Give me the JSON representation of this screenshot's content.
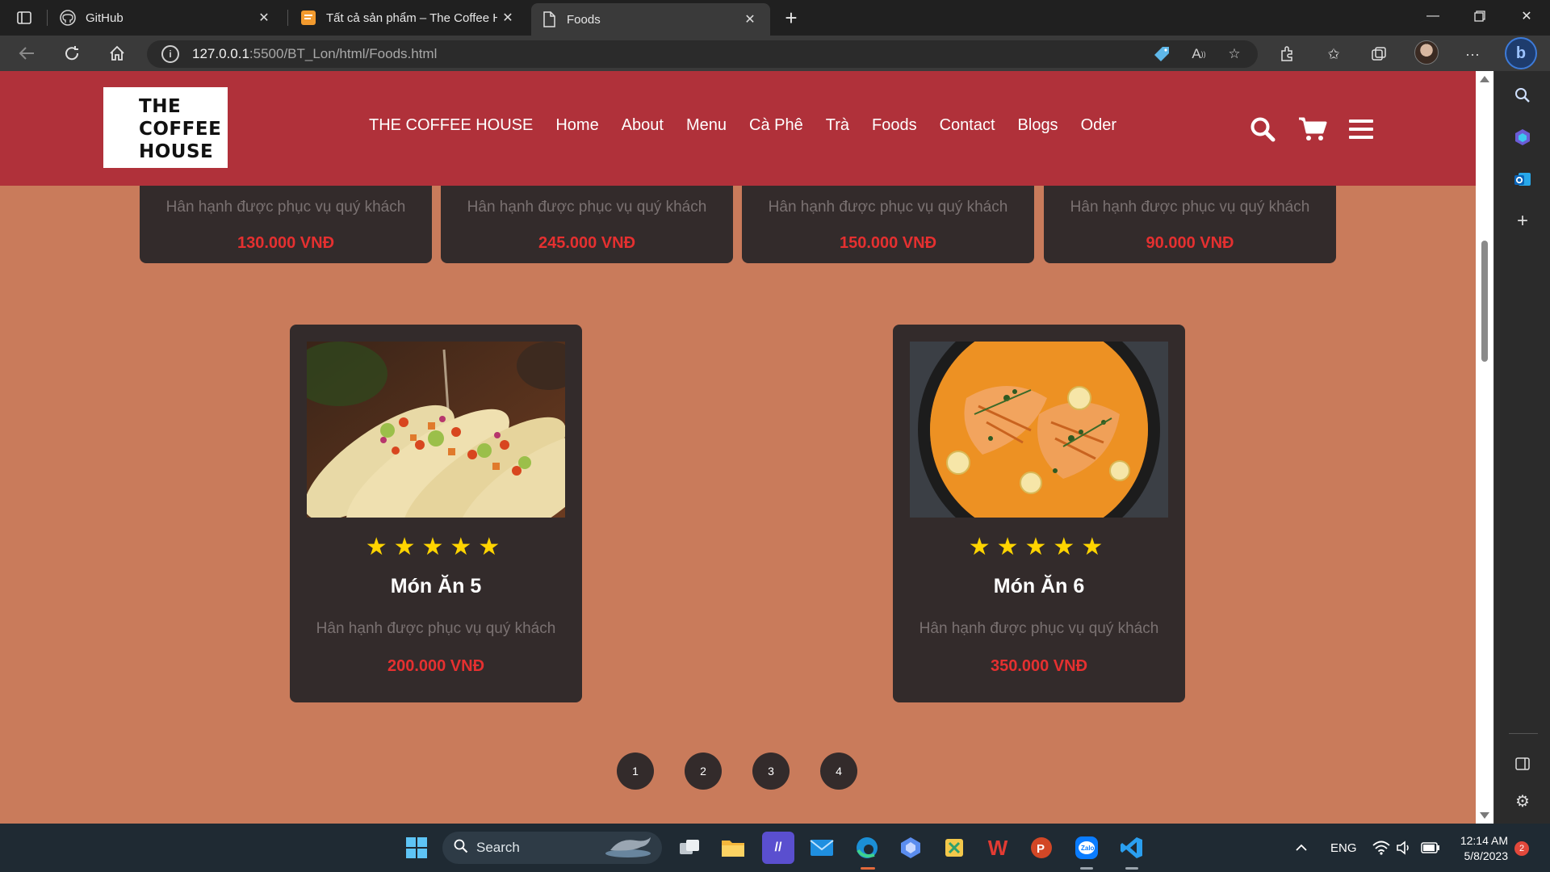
{
  "browser": {
    "tabs": [
      {
        "title": "GitHub",
        "icon": "github-icon",
        "active": false
      },
      {
        "title": "Tất cả sản phẩm – The Coffee Ho",
        "icon": "coffee-house-icon",
        "active": false
      },
      {
        "title": "Foods",
        "icon": "page-icon",
        "active": true
      }
    ],
    "url_host": "127.0.0.1",
    "url_rest": ":5500/BT_Lon/html/Foods.html"
  },
  "site": {
    "logo_lines": [
      "THE",
      "COFFEE",
      "HOUSE"
    ],
    "nav": [
      "THE COFFEE HOUSE",
      "Home",
      "About",
      "Menu",
      "Cà Phê",
      "Trà",
      "Foods",
      "Contact",
      "Blogs",
      "Oder"
    ],
    "top_cards": [
      {
        "desc": "Hân hạnh được phục vụ quý khách",
        "price": "130.000 VNĐ"
      },
      {
        "desc": "Hân hạnh được phục vụ quý khách",
        "price": "245.000 VNĐ"
      },
      {
        "desc": "Hân hạnh được phục vụ quý khách",
        "price": "150.000 VNĐ"
      },
      {
        "desc": "Hân hạnh được phục vụ quý khách",
        "price": "90.000 VNĐ"
      }
    ],
    "products": [
      {
        "name": "Món Ăn 5",
        "stars": "★★★★★",
        "rating": 5,
        "desc": "Hân hạnh được phục vụ quý khách",
        "price": "200.000 VNĐ",
        "image": "tacos-image"
      },
      {
        "name": "Món Ăn 6",
        "stars": "★★★★★",
        "rating": 5,
        "desc": "Hân hạnh được phục vụ quý khách",
        "price": "350.000 VNĐ",
        "image": "salmon-curry-image"
      }
    ],
    "pages": [
      "1",
      "2",
      "3",
      "4"
    ],
    "colors": {
      "header": "#b0313a",
      "background": "#c97b5b",
      "card": "#332b2b",
      "price": "#e53030",
      "stars": "#ffd400"
    }
  },
  "taskbar": {
    "search_label": "Search",
    "language": "ENG",
    "time": "12:14 AM",
    "date": "5/8/2023",
    "notifications": "2"
  }
}
